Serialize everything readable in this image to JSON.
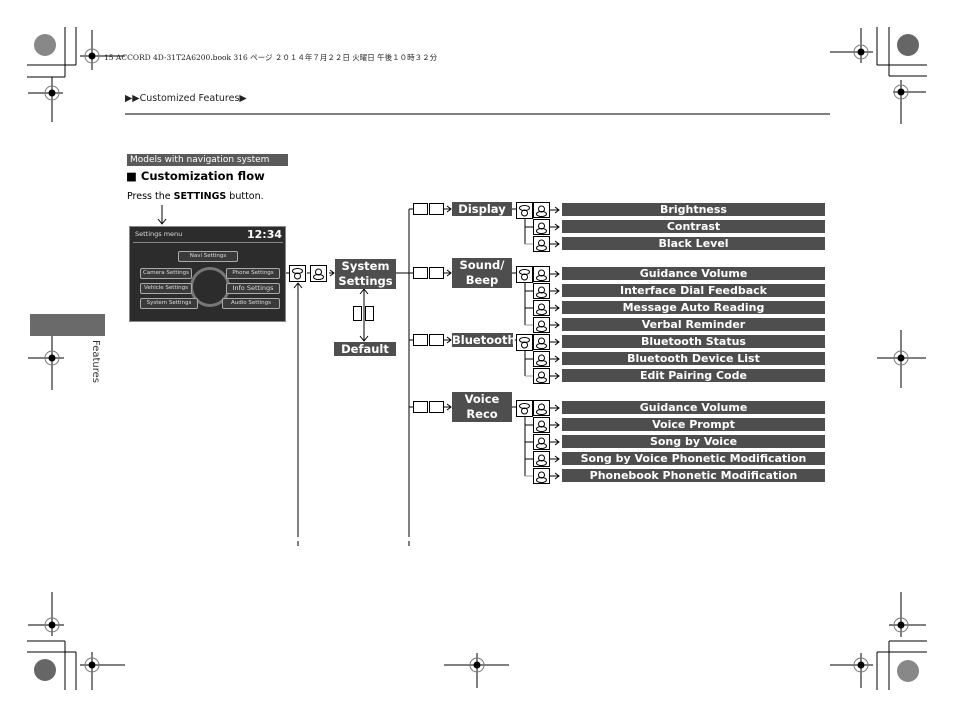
{
  "print_header": {
    "meta": "15 ACCORD 4D-31T2A6200.book  316 ページ  ２０１４年７月２２日  火曜日  午後１０時３２分"
  },
  "breadcrumb": {
    "prefix": "▶▶",
    "label": "Customized Features",
    "suffix": "▶"
  },
  "model_tag": "Models with navigation system",
  "section_title": "Customization flow",
  "section_bullet": "■",
  "instruction": {
    "pre": "Press the ",
    "bold": "SETTINGS",
    "post": " button."
  },
  "settings_screen": {
    "title": "Settings menu",
    "clock": "12:34",
    "buttons": [
      "Navi Settings",
      "Camera Settings",
      "Phone Settings",
      "Vehicle Settings",
      "Info Settings",
      "System Settings",
      "Audio Settings"
    ]
  },
  "flow": {
    "root": "System Settings",
    "root_lines": [
      "System",
      "Settings"
    ],
    "default": "Default",
    "categories": [
      {
        "lines": [
          "Display"
        ],
        "items": [
          "Brightness",
          "Contrast",
          "Black Level"
        ]
      },
      {
        "lines": [
          "Sound/",
          "Beep"
        ],
        "items": [
          "Guidance Volume",
          "Interface Dial Feedback",
          "Message Auto Reading",
          "Verbal Reminder"
        ]
      },
      {
        "lines": [
          "Bluetooth"
        ],
        "items": [
          "Bluetooth Status",
          "Bluetooth Device List",
          "Edit Pairing Code"
        ]
      },
      {
        "lines": [
          "Voice",
          "Reco"
        ],
        "items": [
          "Guidance Volume",
          "Voice Prompt",
          "Song by Voice",
          "Song by Voice Phonetic Modification",
          "Phonebook Phonetic Modification"
        ]
      }
    ]
  },
  "side_tab": "Features",
  "page_number": "316",
  "icons": {
    "interface_dial_rotate": "rotate-knob-icon",
    "interface_dial_select": "press-knob-icon",
    "back": "back-icon",
    "move": "move-up-down-icon"
  },
  "colors": {
    "dark_bar": "#4e4e4e",
    "side_tab": "#6a6a6a",
    "tag": "#5a5a5a"
  }
}
